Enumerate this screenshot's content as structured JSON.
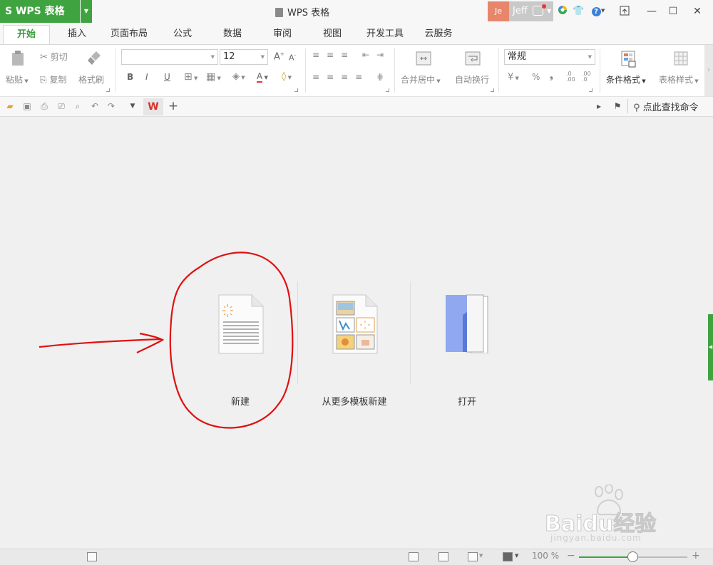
{
  "app": {
    "name": "WPS 表格",
    "window_title": "WPS 表格"
  },
  "user": {
    "avatar_text": "Je",
    "name": "Jeff"
  },
  "tabs": [
    "开始",
    "插入",
    "页面布局",
    "公式",
    "数据",
    "审阅",
    "视图",
    "开发工具",
    "云服务"
  ],
  "active_tab": "开始",
  "ribbon": {
    "clipboard": {
      "paste": "粘贴",
      "cut": "剪切",
      "copy": "复制",
      "format_painter": "格式刷"
    },
    "font": {
      "name": "",
      "size": "12",
      "bold": "B",
      "italic": "I",
      "underline": "U",
      "grow": "A",
      "shrink": "A",
      "font_color": "A"
    },
    "alignment": {
      "merge_center": "合并居中",
      "wrap_text": "自动换行"
    },
    "number": {
      "format": "常规",
      "percent": "%",
      "comma": "❟",
      "inc_decimal": ".0\n.00",
      "dec_decimal": ".00\n.0"
    },
    "styles": {
      "conditional_format": "条件格式",
      "table_style": "表格样式"
    }
  },
  "search": {
    "placeholder": "点此查找命令"
  },
  "start_items": [
    {
      "label": "新建"
    },
    {
      "label": "从更多模板新建"
    },
    {
      "label": "打开"
    }
  ],
  "status": {
    "zoom": "100 %",
    "zoom_fraction": 0.5
  },
  "watermark": {
    "brand": "Baidu经验",
    "url": "jingyan.baidu.com"
  },
  "colors": {
    "accent": "#3fa33f",
    "annotation": "#e01010",
    "avatar": "#e7866b"
  }
}
